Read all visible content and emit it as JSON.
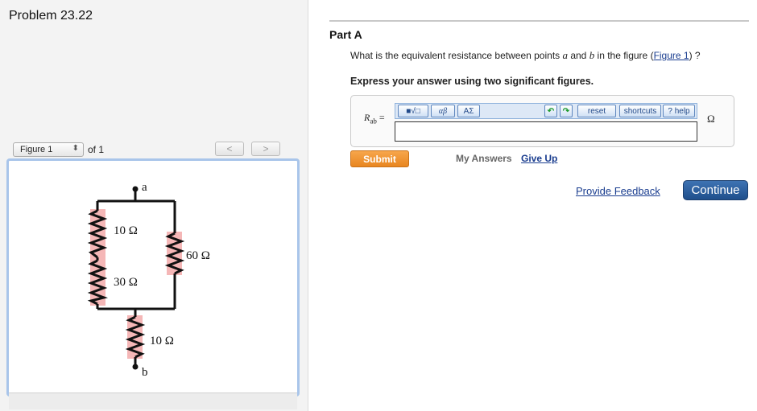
{
  "header": {
    "problem_title": "Problem 23.22"
  },
  "figure_panel": {
    "selected_figure": "Figure 1",
    "of_text": "of 1",
    "prev_glyph": "<",
    "next_glyph": ">",
    "circuit": {
      "node_a": "a",
      "node_b": "b",
      "r_top_left": "10 Ω",
      "r_bottom_left": "30 Ω",
      "r_right": "60 Ω",
      "r_bottom": "10 Ω"
    }
  },
  "part": {
    "title": "Part A",
    "question_pre": "What is the equivalent resistance between points ",
    "var_a": "a",
    "question_and": " and ",
    "var_b": "b",
    "question_mid": " in the figure (",
    "figure_link": "Figure 1",
    "question_post": ") ?",
    "instruction": "Express your answer using two significant figures."
  },
  "answer": {
    "var_label": "R",
    "var_sub": "ab",
    "equals": " =",
    "unit": "Ω",
    "input_value": "",
    "toolbar": {
      "templates": "■√□",
      "greek": "αβ",
      "symbols": "ΑΣ",
      "undo": "↶",
      "redo": "↷",
      "reset": "reset",
      "shortcuts": "shortcuts",
      "help": "? help"
    }
  },
  "actions": {
    "submit": "Submit",
    "my_answers": "My Answers",
    "give_up": "Give Up",
    "provide_feedback": "Provide Feedback",
    "continue": "Continue"
  },
  "colors": {
    "accent_orange": "#e88620",
    "accent_blue": "#1f4f8c",
    "link_blue": "#1a3d8f",
    "figure_frame": "#a9c5ea",
    "resistor_highlight": "#f5b7b7"
  }
}
